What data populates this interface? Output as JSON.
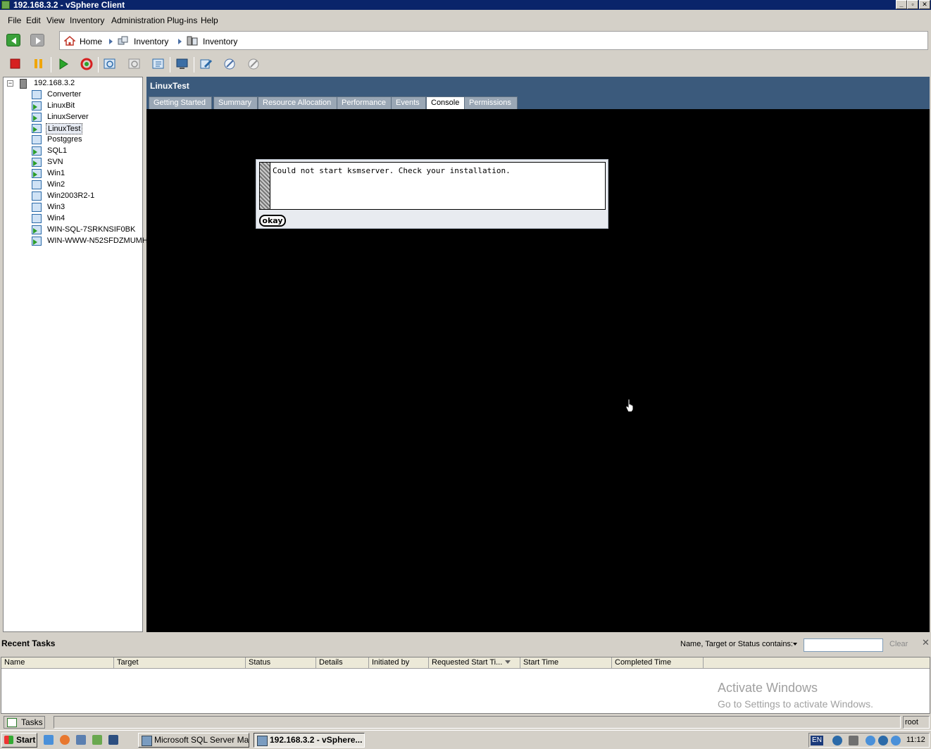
{
  "window": {
    "title": "192.168.3.2 - vSphere Client"
  },
  "menu": [
    "File",
    "Edit",
    "View",
    "Inventory",
    "Administration",
    "Plug-ins",
    "Help"
  ],
  "breadcrumb": [
    "Home",
    "Inventory",
    "Inventory"
  ],
  "tree": {
    "host": "192.168.3.2",
    "vms": [
      {
        "name": "Converter",
        "powered_on": false
      },
      {
        "name": "LinuxBit",
        "powered_on": true
      },
      {
        "name": "LinuxServer",
        "powered_on": true
      },
      {
        "name": "LinuxTest",
        "powered_on": true,
        "selected": true
      },
      {
        "name": "Postggres",
        "powered_on": false
      },
      {
        "name": "SQL1",
        "powered_on": true
      },
      {
        "name": "SVN",
        "powered_on": true
      },
      {
        "name": "Win1",
        "powered_on": true
      },
      {
        "name": "Win2",
        "powered_on": false
      },
      {
        "name": "Win2003R2-1",
        "powered_on": false
      },
      {
        "name": "Win3",
        "powered_on": false
      },
      {
        "name": "Win4",
        "powered_on": false
      },
      {
        "name": "WIN-SQL-7SRKNSIF0BK",
        "powered_on": true
      },
      {
        "name": "WIN-WWW-N52SFDZMUMH",
        "powered_on": true
      }
    ]
  },
  "detail": {
    "title": "LinuxTest",
    "tabs": [
      "Getting Started",
      "Summary",
      "Resource Allocation",
      "Performance",
      "Events",
      "Console",
      "Permissions"
    ],
    "active_tab": "Console"
  },
  "console": {
    "message": "Could not start ksmserver. Check your installation.",
    "button": "okay"
  },
  "recent_tasks": {
    "title": "Recent Tasks",
    "filter_label": "Name, Target or Status contains:",
    "filter_value": "",
    "clear_label": "Clear",
    "columns": [
      "Name",
      "Target",
      "Status",
      "Details",
      "Initiated by",
      "Requested Start Ti...",
      "Start Time",
      "Completed Time"
    ]
  },
  "watermark": {
    "title": "Activate Windows",
    "subtitle": "Go to Settings to activate Windows."
  },
  "statusbar": {
    "tasks_label": "Tasks",
    "user": "root"
  },
  "taskbar": {
    "start_label": "Start",
    "windows": [
      "Microsoft SQL Server Ma...",
      "192.168.3.2 - vSphere..."
    ],
    "language": "EN",
    "clock": "11:12"
  },
  "colors": {
    "titlebar": "#0a246a",
    "pane_header": "#3b5a7c",
    "console_bg": "#000000"
  }
}
